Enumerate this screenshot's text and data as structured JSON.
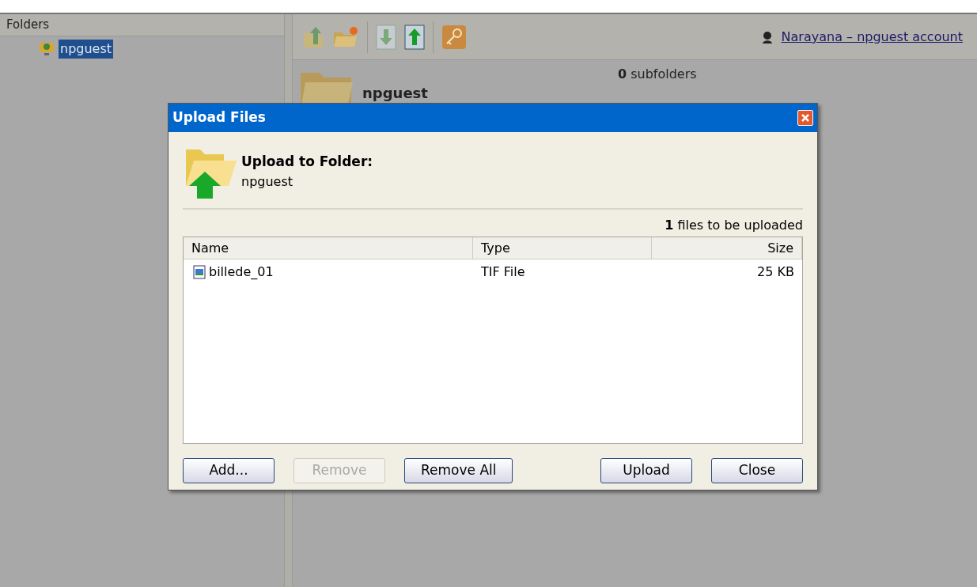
{
  "sidebar": {
    "title": "Folders",
    "items": [
      {
        "label": "npguest",
        "selected": true
      }
    ]
  },
  "toolbar": {
    "account_link": "Narayana – npguest account"
  },
  "folder_info": {
    "name": "npguest",
    "subfolders_count": "0",
    "subfolders_label": "subfolders"
  },
  "dialog": {
    "title": "Upload Files",
    "heading": "Upload to Folder:",
    "folder": "npguest",
    "count": "1",
    "count_label": "files to be uploaded",
    "columns": [
      "Name",
      "Type",
      "Size"
    ],
    "rows": [
      {
        "name": "billede_01",
        "type": "TIF File",
        "size": "25 KB"
      }
    ],
    "buttons": [
      {
        "label": "Add...",
        "disabled": false
      },
      {
        "label": "Remove",
        "disabled": true
      },
      {
        "label": "Remove All",
        "disabled": false
      },
      {
        "label": "Upload",
        "disabled": false
      },
      {
        "label": "Close",
        "disabled": false
      }
    ]
  }
}
